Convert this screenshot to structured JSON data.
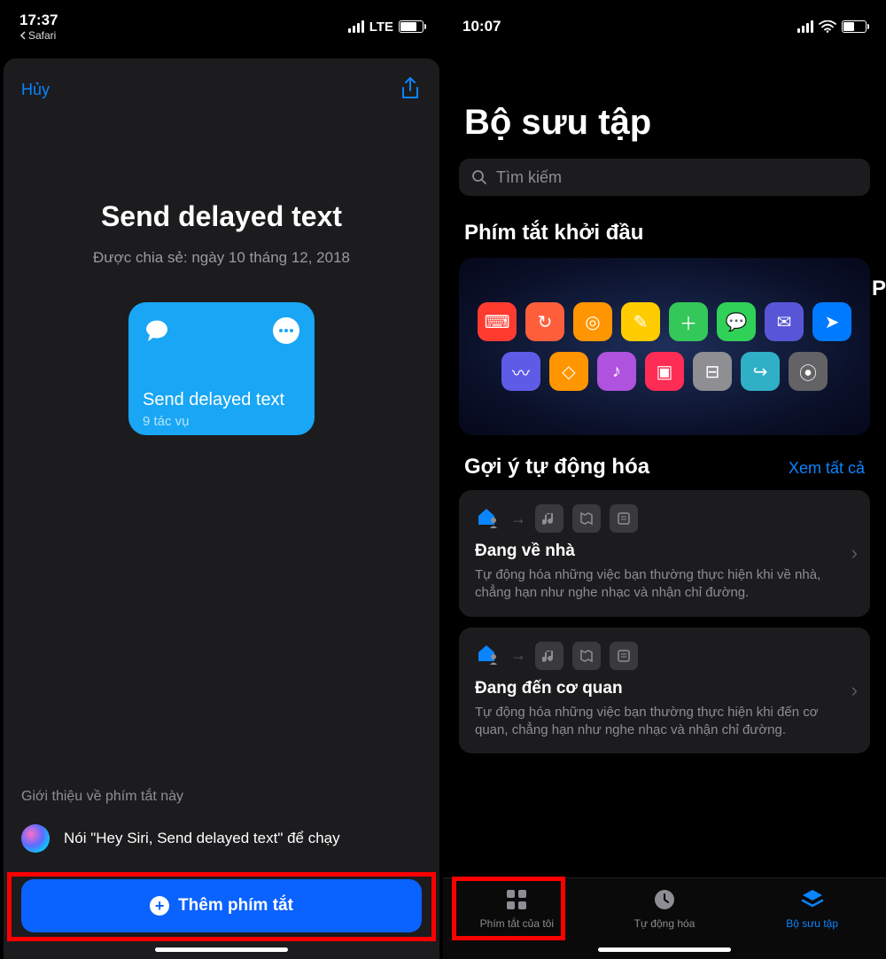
{
  "left": {
    "status": {
      "time": "17:37",
      "back_app": "Safari",
      "network": "LTE"
    },
    "cancel": "Hủy",
    "title": "Send delayed text",
    "shared_line": "Được chia sẻ: ngày 10 tháng 12, 2018",
    "card": {
      "title": "Send delayed text",
      "subtitle": "9 tác vụ"
    },
    "about_label": "Giới thiệu về phím tắt này",
    "siri_text": "Nói \"Hey Siri, Send delayed text\" để chạy",
    "add_button": "Thêm phím tắt"
  },
  "right": {
    "status": {
      "time": "10:07"
    },
    "page_title": "Bộ sưu tập",
    "search_placeholder": "Tìm kiếm",
    "starter_title": "Phím tắt khởi đầu",
    "peek_letter": "P",
    "automation": {
      "title": "Gợi ý tự động hóa",
      "see_all": "Xem tất cả",
      "items": [
        {
          "title": "Đang về nhà",
          "desc": "Tự động hóa những việc bạn thường thực hiện khi về nhà, chẳng hạn như nghe nhạc và nhận chỉ đường."
        },
        {
          "title": "Đang đến cơ quan",
          "desc": "Tự động hóa những việc bạn thường thực hiện khi đến cơ quan, chẳng hạn như nghe nhạc và nhận chỉ đường."
        }
      ]
    },
    "tabs": {
      "my": "Phím tắt của tôi",
      "auto": "Tự động hóa",
      "gallery": "Bộ sưu tập"
    },
    "starter_icons": {
      "row1": [
        "#ff3b30",
        "#ff5e3a",
        "#ff9500",
        "#ffcc00",
        "#34c759",
        "#30d158",
        "#5856d6",
        "#007aff"
      ],
      "row2": [
        "#5e5ce6",
        "#ff9500",
        "#af52de",
        "#ff2d55",
        "#8e8e93",
        "#30b0c7",
        "#636366"
      ]
    }
  }
}
